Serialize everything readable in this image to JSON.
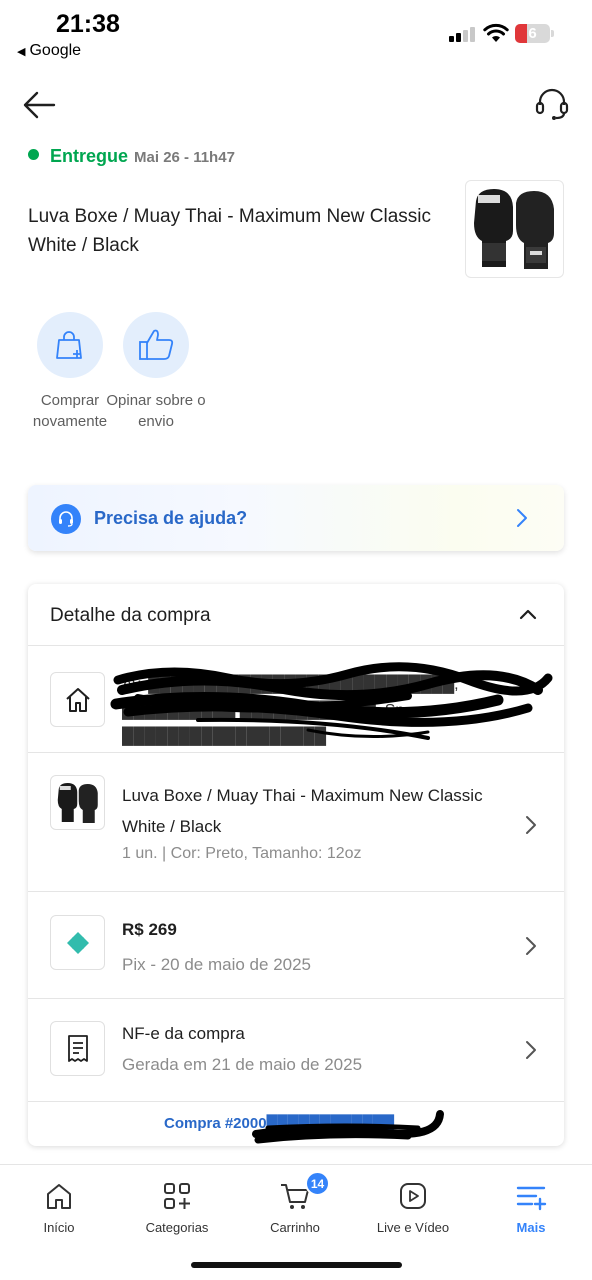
{
  "status_bar": {
    "time": "21:38",
    "back_app": "Google",
    "battery": "6"
  },
  "order": {
    "status": "Entregue",
    "date": "Mai 26 - 11h47",
    "product_title": "Luva Boxe / Muay Thai - Maximum New Classic White / Black"
  },
  "actions": [
    {
      "label": "Comprar novamente",
      "icon": "bag-plus-icon"
    },
    {
      "label": "Opinar sobre o envio",
      "icon": "thumbs-up-icon"
    }
  ],
  "help": {
    "label": "Precisa de ajuda?"
  },
  "detail": {
    "title": "Detalhe da compra",
    "address": "Av. ███████████████████████████, ██████████ ████████████, Sp ██████████████████",
    "item": {
      "title": "Luva Boxe / Muay Thai - Maximum New Classic White / Black",
      "subtitle": "1 un. | Cor: Preto, Tamanho: 12oz"
    },
    "payment": {
      "amount": "R$ 269",
      "method": "Pix - 20 de maio de 2025"
    },
    "invoice": {
      "title": "NF-e da compra",
      "subtitle": "Gerada em 21 de maio de 2025"
    },
    "order_number": "Compra #2000████████████"
  },
  "bottom_nav": {
    "tabs": [
      {
        "label": "Início",
        "icon": "home-icon"
      },
      {
        "label": "Categorias",
        "icon": "grid-plus-icon"
      },
      {
        "label": "Carrinho",
        "icon": "cart-icon"
      },
      {
        "label": "Live e Vídeo",
        "icon": "play-icon"
      },
      {
        "label": "Mais",
        "icon": "menu-plus-icon"
      }
    ],
    "cart_badge": "14",
    "active": "Mais"
  },
  "colors": {
    "accent": "#3483fa",
    "success": "#00a650",
    "link": "#2968c8"
  }
}
